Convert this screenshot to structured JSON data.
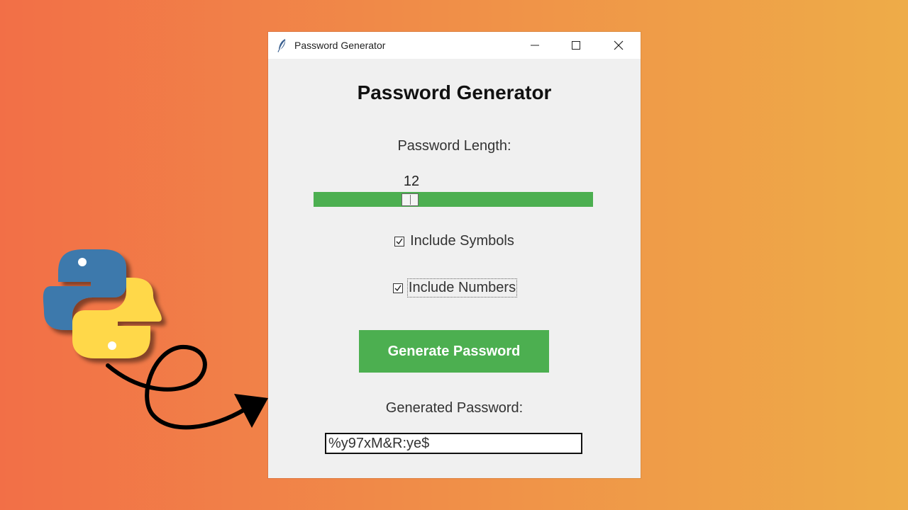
{
  "window": {
    "title": "Password Generator"
  },
  "app": {
    "heading": "Password Generator",
    "length_label": "Password Length:",
    "length_value": "12",
    "symbols_label": "Include Symbols",
    "symbols_checked": true,
    "numbers_label": "Include Numbers",
    "numbers_checked": true,
    "generate_label": "Generate Password",
    "output_label": "Generated Password:",
    "output_value": "%y97xM&R:ye$"
  },
  "colors": {
    "accent": "#4caf50",
    "background_gradient_start": "#f26f47",
    "background_gradient_end": "#eeac48"
  },
  "icons": [
    "feather-icon",
    "minimize-icon",
    "maximize-icon",
    "close-icon",
    "python-logo",
    "curved-arrow"
  ]
}
